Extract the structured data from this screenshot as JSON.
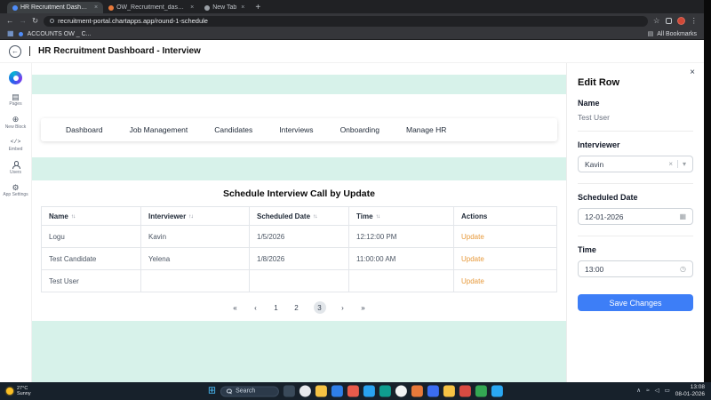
{
  "colors": {
    "accent_blue": "#3d7ef7",
    "mint_section": "#d7f2ea",
    "update_orange": "#e79a3c",
    "taskbar": "#17212b"
  },
  "browser": {
    "tabs": [
      {
        "title": "HR Recruitment Dashboard"
      },
      {
        "title": "OW_Recruitment_dashboard"
      },
      {
        "title": "New Tab"
      }
    ],
    "url": "recruitment-portal.chartapps.app/round-1-schedule",
    "bookmark_label": "ACCOUNTS OW _ C...",
    "all_bookmarks_label": "All Bookmarks"
  },
  "app": {
    "title": "HR Recruitment Dashboard - Interview",
    "rail": {
      "items": [
        {
          "label": "Pages"
        },
        {
          "label": "New Block"
        },
        {
          "label": "Embed"
        },
        {
          "label": "Users"
        },
        {
          "label": "App Settings"
        }
      ]
    },
    "nav": {
      "items": [
        "Dashboard",
        "Job Management",
        "Candidates",
        "Interviews",
        "Onboarding",
        "Manage HR"
      ]
    },
    "section_title": "Schedule Interview Call by Update",
    "table": {
      "columns": [
        "Name",
        "Interviewer",
        "Scheduled Date",
        "Time",
        "Actions"
      ],
      "rows": [
        {
          "name": "Logu",
          "interviewer": "Kavin",
          "date": "1/5/2026",
          "time": "12:12:00 PM",
          "action": "Update"
        },
        {
          "name": "Test Candidate",
          "interviewer": "Yelena",
          "date": "1/8/2026",
          "time": "11:00:00 AM",
          "action": "Update"
        },
        {
          "name": "Test User",
          "interviewer": "",
          "date": "",
          "time": "",
          "action": "Update"
        }
      ]
    },
    "pagination": {
      "items": [
        "«",
        "‹",
        "1",
        "2",
        "3",
        "›",
        "»"
      ],
      "active": "3"
    },
    "panel": {
      "title": "Edit Row",
      "name_label": "Name",
      "name_value": "Test User",
      "interviewer_label": "Interviewer",
      "interviewer_value": "Kavin",
      "date_label": "Scheduled Date",
      "date_value": "12-01-2026",
      "time_label": "Time",
      "time_value": "13:00",
      "save_label": "Save Changes"
    }
  },
  "taskbar": {
    "weather_temp": "27°C",
    "weather_desc": "Sunny",
    "search_label": "Search",
    "time": "13:08",
    "date": "08-01-2026"
  },
  "icons": {
    "back_arrow": "←",
    "forward_arrow": "→",
    "reload": "↻",
    "star": "☆",
    "menu_dots": "⋮",
    "close": "×",
    "new_tab": "+",
    "apps_grid": "▦",
    "folder": "▤",
    "sort": "↑↓",
    "clear": "×",
    "chevron_down": "▾",
    "calendar": "▦",
    "clock": "◷",
    "start": "⊞",
    "pages": "▤",
    "new_block": "⊕",
    "embed": "</>",
    "settings": "⚙",
    "tray_chevron": "∧",
    "wifi": "≈",
    "volume": "◁",
    "battery": "▭"
  }
}
